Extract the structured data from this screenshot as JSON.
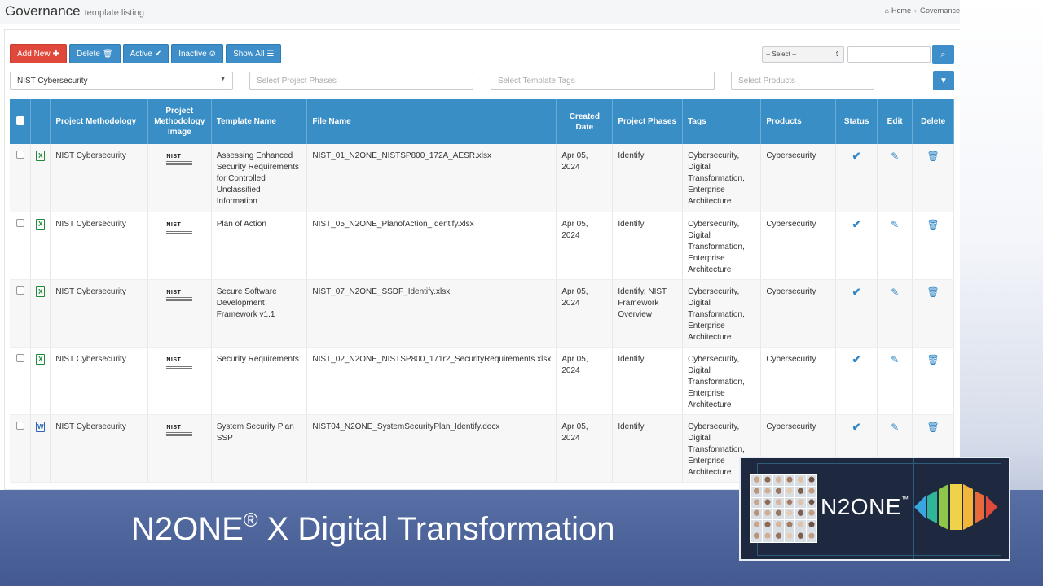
{
  "header": {
    "title": "Governance",
    "subtitle": "template listing",
    "breadcrumb": {
      "home": "Home",
      "current": "Governance"
    }
  },
  "toolbar": {
    "add_new": "Add New",
    "delete": "Delete",
    "active": "Active",
    "inactive": "Inactive",
    "show_all": "Show All",
    "select_value": "-- Select --",
    "search_value": ""
  },
  "filters": {
    "methodology": "NIST Cybersecurity",
    "phases_placeholder": "Select Project Phases",
    "tags_placeholder": "Select Template Tags",
    "products_placeholder": "Select Products"
  },
  "table": {
    "columns": [
      "Project Methodology",
      "Project Methodology Image",
      "Template Name",
      "File Name",
      "Created Date",
      "Project Phases",
      "Tags",
      "Products",
      "Status",
      "Edit",
      "Delete"
    ],
    "image_logo_text": "NIST",
    "rows": [
      {
        "file_type": "xlsx",
        "file_icon_letter": "X",
        "methodology": "NIST Cybersecurity",
        "template_name": "Assessing Enhanced Security Requirements for Controlled Unclassified Information",
        "file_name": "NIST_01_N2ONE_NISTSP800_172A_AESR.xlsx",
        "created": "Apr 05, 2024",
        "phases": "Identify",
        "tags": "Cybersecurity, Digital Transformation, Enterprise Architecture",
        "products": "Cybersecurity"
      },
      {
        "file_type": "xlsx",
        "file_icon_letter": "X",
        "methodology": "NIST Cybersecurity",
        "template_name": "Plan of Action",
        "file_name": "NIST_05_N2ONE_PlanofAction_Identify.xlsx",
        "created": "Apr 05, 2024",
        "phases": "Identify",
        "tags": "Cybersecurity, Digital Transformation, Enterprise Architecture",
        "products": "Cybersecurity"
      },
      {
        "file_type": "xlsx",
        "file_icon_letter": "X",
        "methodology": "NIST Cybersecurity",
        "template_name": "Secure Software Development Framework v1.1",
        "file_name": "NIST_07_N2ONE_SSDF_Identify.xlsx",
        "created": "Apr 05, 2024",
        "phases": "Identify, NIST Framework Overview",
        "tags": "Cybersecurity, Digital Transformation, Enterprise Architecture",
        "products": "Cybersecurity"
      },
      {
        "file_type": "xlsx",
        "file_icon_letter": "X",
        "methodology": "NIST Cybersecurity",
        "template_name": "Security Requirements",
        "file_name": "NIST_02_N2ONE_NISTSP800_171r2_SecurityRequirements.xlsx",
        "created": "Apr 05, 2024",
        "phases": "Identify",
        "tags": "Cybersecurity, Digital Transformation, Enterprise Architecture",
        "products": "Cybersecurity"
      },
      {
        "file_type": "docx",
        "file_icon_letter": "W",
        "methodology": "NIST Cybersecurity",
        "template_name": "System Security Plan SSP",
        "file_name": "NIST04_N2ONE_SystemSecurityPlan_Identify.docx",
        "created": "Apr 05, 2024",
        "phases": "Identify",
        "tags": "Cybersecurity, Digital Transformation, Enterprise Architecture",
        "products": "Cybersecurity"
      }
    ]
  },
  "banner": {
    "headline_main": "N2ONE",
    "registered_mark": "®",
    "headline_rest": " X Digital Transformation"
  },
  "logo_card": {
    "brand": "N2ONE",
    "trademark": "™"
  },
  "colors": {
    "header_blue": "#3a8ec6",
    "button_blue": "#3d8ec9",
    "button_red": "#e0483c",
    "banner_blue": "#4d6399"
  }
}
